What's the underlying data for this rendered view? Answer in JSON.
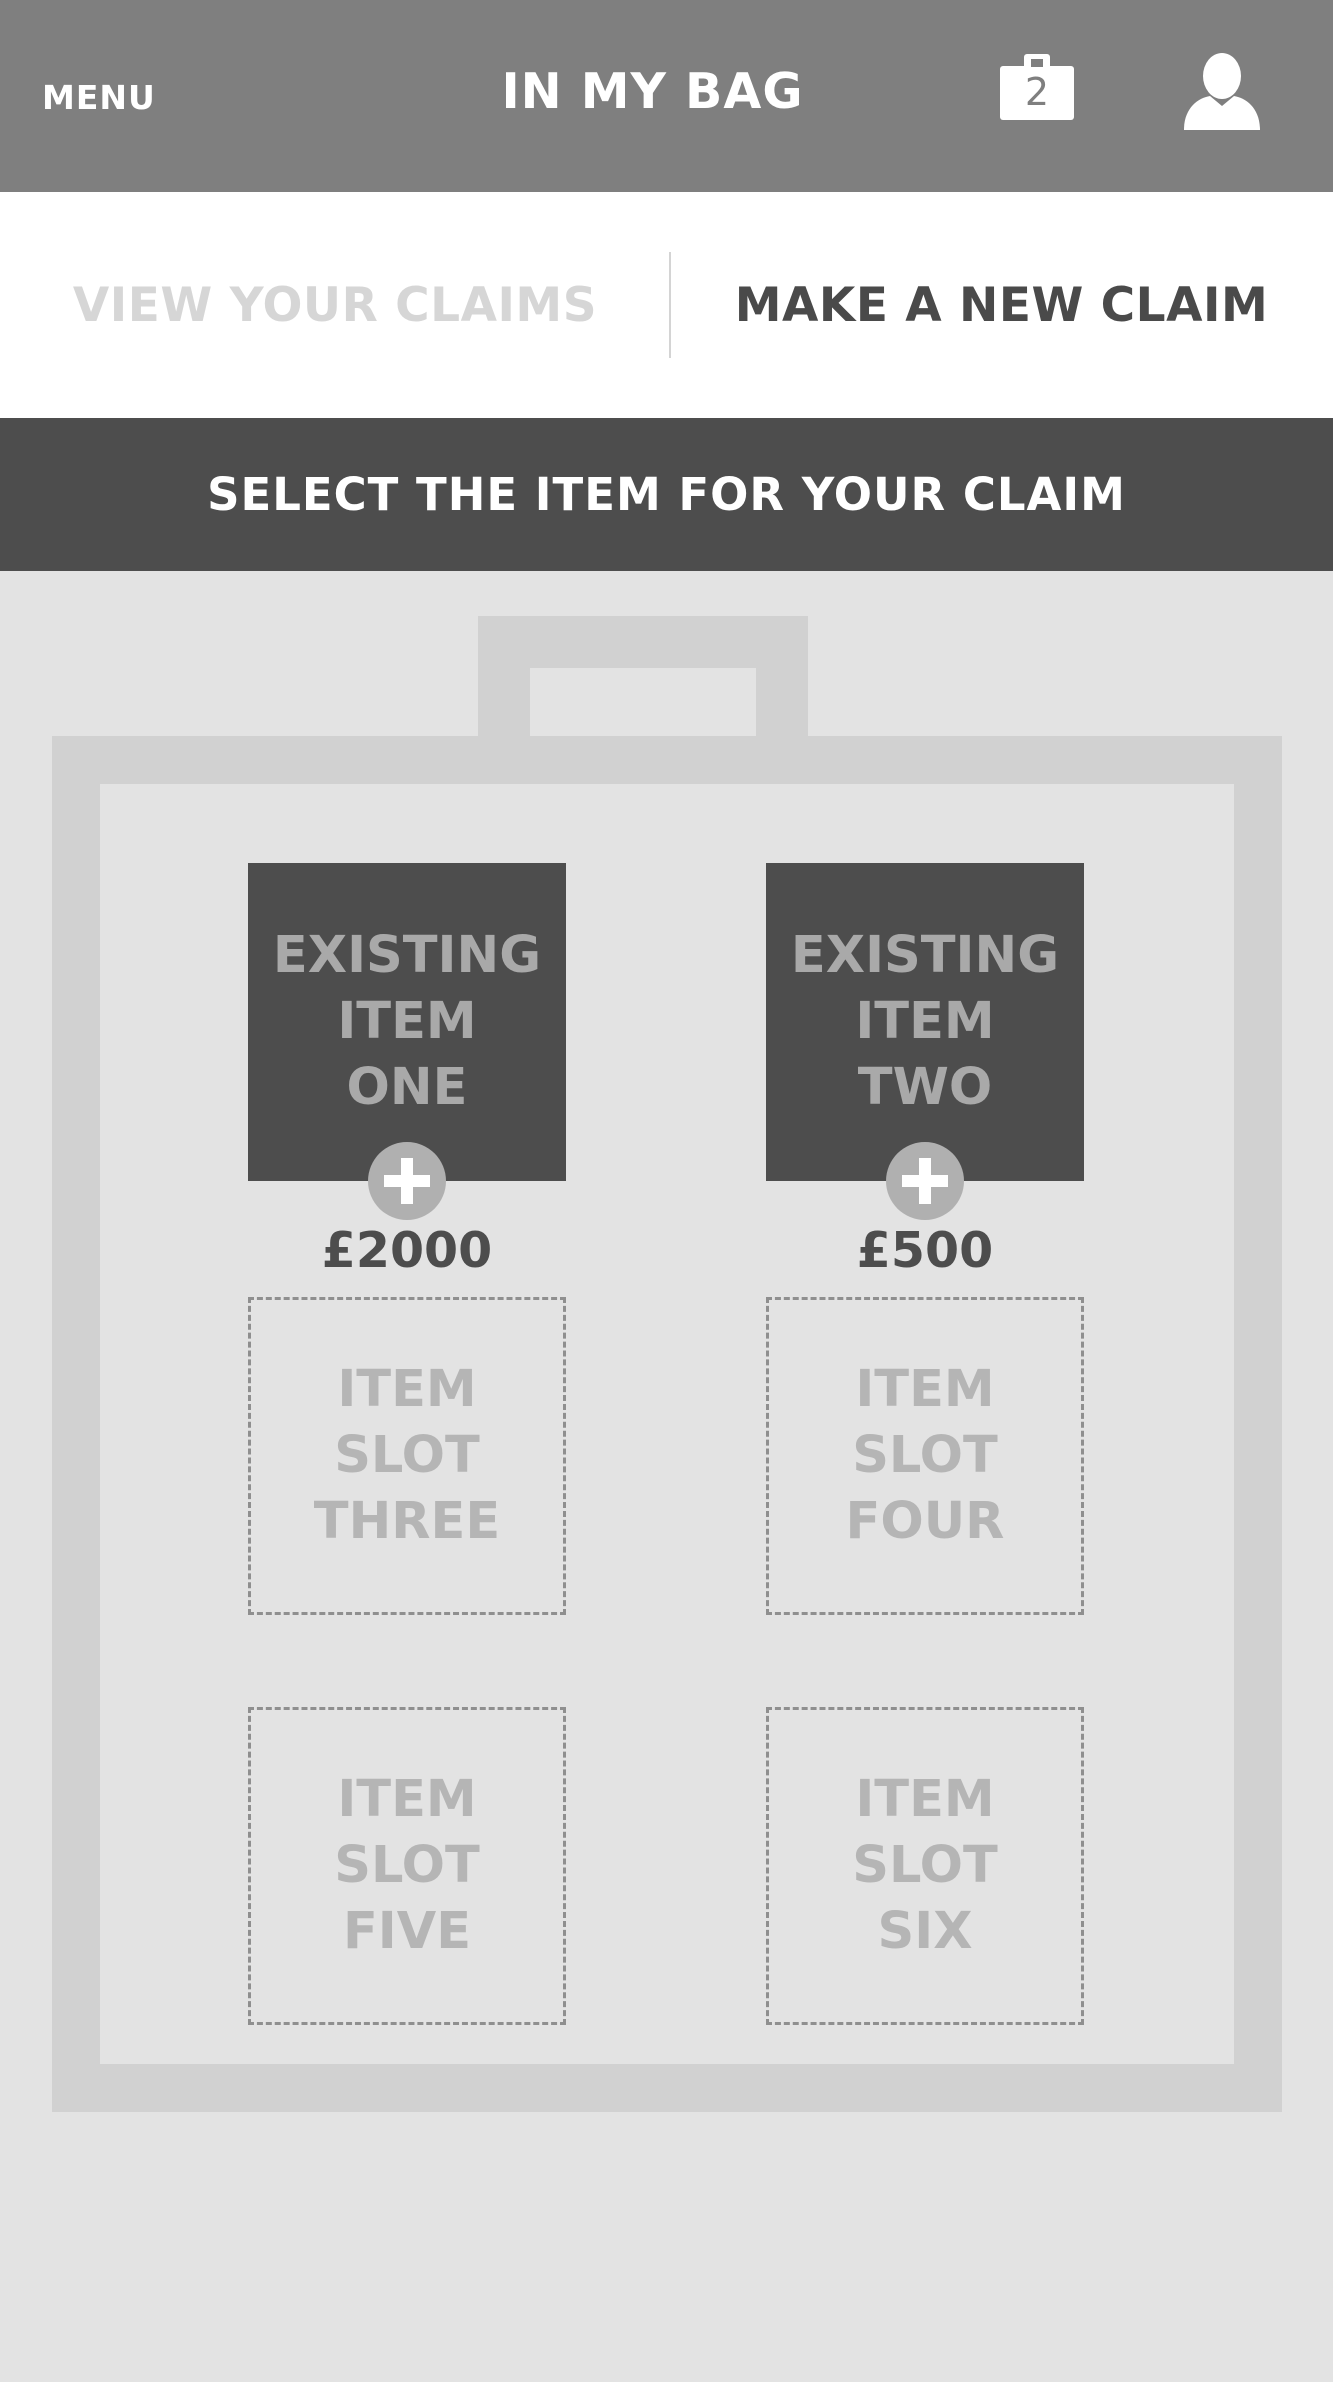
{
  "header": {
    "menu_label": "MENU",
    "title": "IN MY BAG",
    "bag_count": "2",
    "bag_icon": "bag-icon",
    "user_icon": "user-icon"
  },
  "tabs": [
    {
      "label": "VIEW YOUR CLAIMS",
      "active": false
    },
    {
      "label": "MAKE A NEW CLAIM",
      "active": true
    }
  ],
  "banner": {
    "text": "SELECT THE ITEM FOR YOUR CLAIM"
  },
  "items": [
    {
      "lines": [
        "EXISTING",
        "ITEM",
        "ONE"
      ],
      "filled": true,
      "price": "£2000"
    },
    {
      "lines": [
        "EXISTING",
        "ITEM",
        "TWO"
      ],
      "filled": true,
      "price": "£500"
    },
    {
      "lines": [
        "ITEM",
        "SLOT",
        "THREE"
      ],
      "filled": false
    },
    {
      "lines": [
        "ITEM",
        "SLOT",
        "FOUR"
      ],
      "filled": false
    },
    {
      "lines": [
        "ITEM",
        "SLOT",
        "FIVE"
      ],
      "filled": false
    },
    {
      "lines": [
        "ITEM",
        "SLOT",
        "SIX"
      ],
      "filled": false
    }
  ],
  "colors": {
    "header_bg": "#7f7f7f",
    "banner_bg": "#4d4d4d",
    "page_bg": "#e3e3e3",
    "bag_outline": "#d1d1d1"
  }
}
